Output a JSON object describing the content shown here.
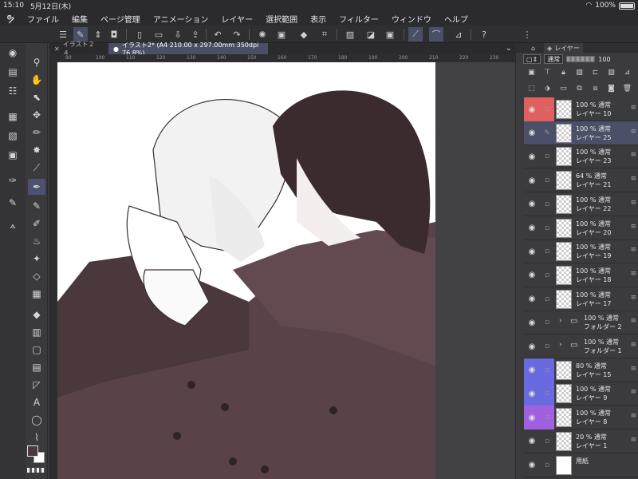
{
  "status": {
    "time": "15:10",
    "date": "5月12日(木)",
    "battery": "100%"
  },
  "menu": {
    "items": [
      "ファイル",
      "編集",
      "ページ管理",
      "アニメーション",
      "レイヤー",
      "選択範囲",
      "表示",
      "フィルター",
      "ウィンドウ",
      "ヘルプ"
    ]
  },
  "tabs": {
    "inactive": "イラスト２４",
    "active": "イラスト2* (A4 210.00 x 297.00mm 350dpi 76.8%)"
  },
  "ruler": {
    "ticks": [
      "90",
      "100",
      "110",
      "120",
      "130",
      "140",
      "150",
      "160",
      "170",
      "180",
      "190",
      "200",
      "210",
      "220",
      "230"
    ]
  },
  "panel": {
    "tab_label": "レイヤー",
    "blend_mode": "通常",
    "opacity": "100"
  },
  "layers": [
    {
      "line1": "100 % 通常",
      "line2": "レイヤー 10",
      "color": "#e06060",
      "selected": false,
      "type": "layer"
    },
    {
      "line1": "100 % 通常",
      "line2": "レイヤー 25",
      "color": "",
      "selected": true,
      "type": "layer"
    },
    {
      "line1": "100 % 通常",
      "line2": "レイヤー 23",
      "color": "",
      "selected": false,
      "type": "layer"
    },
    {
      "line1": "64 % 通常",
      "line2": "レイヤー 21",
      "color": "",
      "selected": false,
      "type": "layer"
    },
    {
      "line1": "100 % 通常",
      "line2": "レイヤー 22",
      "color": "",
      "selected": false,
      "type": "layer"
    },
    {
      "line1": "100 % 通常",
      "line2": "レイヤー 20",
      "color": "",
      "selected": false,
      "type": "layer"
    },
    {
      "line1": "100 % 通常",
      "line2": "レイヤー 19",
      "color": "",
      "selected": false,
      "type": "layer"
    },
    {
      "line1": "100 % 通常",
      "line2": "レイヤー 18",
      "color": "",
      "selected": false,
      "type": "layer"
    },
    {
      "line1": "100 % 通常",
      "line2": "レイヤー 17",
      "color": "",
      "selected": false,
      "type": "layer"
    },
    {
      "line1": "100 % 通常",
      "line2": "フォルダー 2",
      "color": "",
      "selected": false,
      "type": "folder"
    },
    {
      "line1": "100 % 通常",
      "line2": "フォルダー 1",
      "color": "",
      "selected": false,
      "type": "folder"
    },
    {
      "line1": "80 % 通常",
      "line2": "レイヤー 15",
      "color": "#6a6ae0",
      "selected": false,
      "type": "layer"
    },
    {
      "line1": "100 % 通常",
      "line2": "レイヤー 9",
      "color": "#6a6ae0",
      "selected": false,
      "type": "layer"
    },
    {
      "line1": "100 % 通常",
      "line2": "レイヤー 8",
      "color": "#a060e0",
      "selected": false,
      "type": "layer"
    },
    {
      "line1": "20 % 通常",
      "line2": "レイヤー 1",
      "color": "",
      "selected": false,
      "type": "layer"
    },
    {
      "line1": "",
      "line2": "用紙",
      "color": "",
      "selected": false,
      "type": "paper"
    }
  ],
  "colors": {
    "main": "#4a3a40",
    "accent": "#4a4f66"
  }
}
